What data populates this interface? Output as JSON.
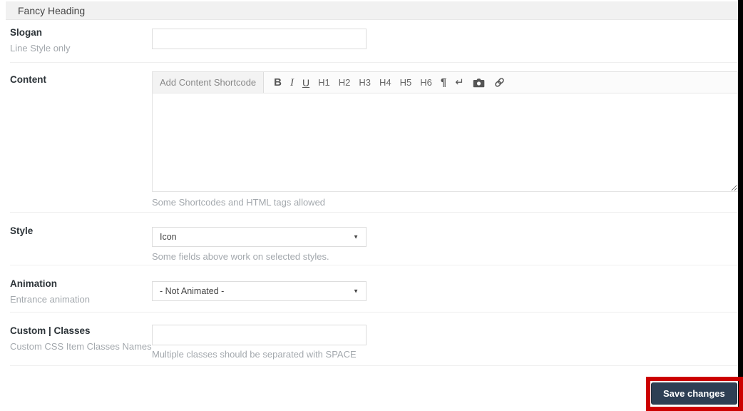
{
  "header": {
    "title": "Fancy Heading"
  },
  "slogan": {
    "label": "Slogan",
    "description": "Line Style only",
    "value": ""
  },
  "content": {
    "label": "Content",
    "shortcode_button": "Add Content Shortcode",
    "toolbar": [
      {
        "name": "bold",
        "label": "B"
      },
      {
        "name": "italic",
        "label": "I"
      },
      {
        "name": "underline",
        "label": "U"
      },
      {
        "name": "heading-1",
        "label": "H1"
      },
      {
        "name": "heading-2",
        "label": "H2"
      },
      {
        "name": "heading-3",
        "label": "H3"
      },
      {
        "name": "heading-4",
        "label": "H4"
      },
      {
        "name": "heading-5",
        "label": "H5"
      },
      {
        "name": "heading-6",
        "label": "H6"
      },
      {
        "name": "paragraph",
        "label": "¶"
      },
      {
        "name": "line-break",
        "label": "↵"
      }
    ],
    "icon_buttons": [
      {
        "name": "camera-icon"
      },
      {
        "name": "link-icon"
      }
    ],
    "textarea_value": "",
    "help": "Some Shortcodes and HTML tags allowed"
  },
  "style": {
    "label": "Style",
    "selected": "Icon",
    "help": "Some fields above work on selected styles."
  },
  "animation": {
    "label": "Animation",
    "description": "Entrance animation",
    "selected": "- Not Animated -"
  },
  "custom_classes": {
    "label": "Custom | Classes",
    "description": "Custom CSS Item Classes Names",
    "value": "",
    "help": "Multiple classes should be separated with SPACE"
  },
  "footer": {
    "save_label": "Save changes"
  },
  "colors": {
    "annotation_red": "#cc0000",
    "save_button_bg": "#2e3f54",
    "header_bar_bg": "#f1f1f1",
    "edge_bar_black": "#000000"
  }
}
